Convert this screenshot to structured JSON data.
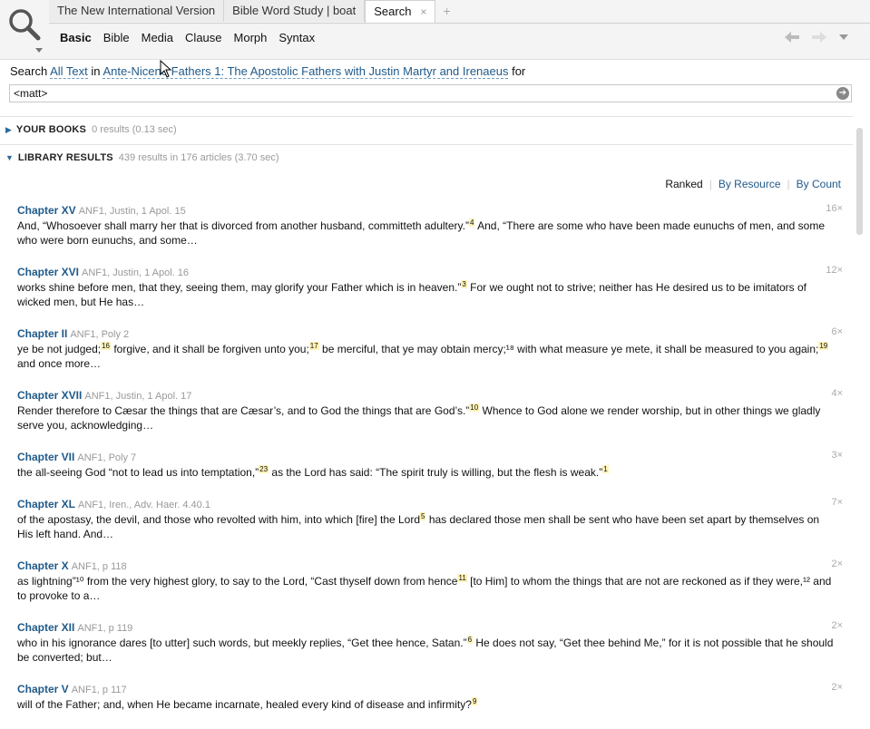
{
  "tabs": [
    {
      "label": "The New International Version",
      "active": false
    },
    {
      "label": "Bible Word Study | boat",
      "active": false
    },
    {
      "label": "Search",
      "active": true
    }
  ],
  "tab_close_glyph": "×",
  "tab_add_glyph": "+",
  "subnav": [
    {
      "label": "Basic",
      "active": true
    },
    {
      "label": "Bible",
      "active": false
    },
    {
      "label": "Media",
      "active": false
    },
    {
      "label": "Clause",
      "active": false
    },
    {
      "label": "Morph",
      "active": false
    },
    {
      "label": "Syntax",
      "active": false
    }
  ],
  "nav": {
    "back_icon": "arrow-left-icon",
    "forward_icon": "arrow-right-icon",
    "menu_icon": "chevron-down-icon"
  },
  "searchline": {
    "prefix": "Search",
    "scope": "All Text",
    "in": "in",
    "resource": "Ante-Nicene Fathers 1: The Apostolic Fathers with Justin Martyr and Irenaeus",
    "for": "for"
  },
  "search": {
    "value": "<matt>"
  },
  "your_books": {
    "label": "YOUR BOOKS",
    "meta": "0 results (0.13 sec)"
  },
  "library": {
    "label": "LIBRARY RESULTS",
    "meta": "439 results in 176 articles (3.70 sec)"
  },
  "sort": {
    "current": "Ranked",
    "opt1": "By Resource",
    "opt2": "By Count"
  },
  "results": [
    {
      "chapter": "Chapter XV",
      "source": "ANF1, Justin, 1 Apol. 15",
      "count": "16×",
      "parts": [
        "And, “Whosoever shall marry her that is divorced from another husband, committeth adultery.”",
        "4",
        " And, “There are some who have been made eunuchs of men, and some who were born eunuchs, and some…"
      ]
    },
    {
      "chapter": "Chapter XVI",
      "source": "ANF1, Justin, 1 Apol. 16",
      "count": "12×",
      "parts": [
        "works shine before men, that they, seeing them, may glorify your Father which is in heaven.”",
        "3",
        " For we ought not to strive; neither has He desired us to be imitators of wicked men, but He has…"
      ]
    },
    {
      "chapter": "Chapter II",
      "source": "ANF1, Poly 2",
      "count": "6×",
      "parts": [
        "ye be not judged;",
        "16",
        " forgive, and it shall be forgiven unto you;",
        "17",
        " be merciful, that ye may obtain mercy;¹⁸ with what measure ye mete, it shall be measured to you again;",
        "19",
        " and once more…"
      ]
    },
    {
      "chapter": "Chapter XVII",
      "source": "ANF1, Justin, 1 Apol. 17",
      "count": "4×",
      "parts": [
        "Render therefore to Cæsar the things that are Cæsar’s, and to God the things that are God’s.”",
        "10",
        " Whence to God alone we render worship, but in other things we gladly serve you, acknowledging…"
      ]
    },
    {
      "chapter": "Chapter VII",
      "source": "ANF1, Poly 7",
      "count": "3×",
      "parts": [
        "the all-seeing God “not to lead us into temptation,”",
        "23",
        " as the Lord has said: “The spirit truly is willing, but the flesh is weak.”",
        "1",
        ""
      ]
    },
    {
      "chapter": "Chapter XL",
      "source": "ANF1, Iren., Adv. Haer. 4.40.1",
      "count": "7×",
      "parts": [
        "of the apostasy, the devil, and those who revolted with him, into which [fire] the Lord",
        "5",
        " has declared those men shall be sent who have been set apart by themselves on His left hand. And…"
      ]
    },
    {
      "chapter": "Chapter X",
      "source": "ANF1, p 118",
      "count": "2×",
      "parts": [
        "as lightning”¹⁰ from the very highest glory, to say to the Lord, “Cast thyself down from hence",
        "11",
        " [to Him] to whom the things that are not are reckoned as if they were,¹² and to provoke to a…"
      ]
    },
    {
      "chapter": "Chapter XII",
      "source": "ANF1, p 119",
      "count": "2×",
      "parts": [
        "who in his ignorance dares [to utter] such words, but meekly replies, “Get thee hence, Satan.”",
        "6",
        " He does not say, “Get thee behind Me,” for it is not possible that he should be converted; but…"
      ]
    },
    {
      "chapter": "Chapter V",
      "source": "ANF1, p 117",
      "count": "2×",
      "parts": [
        "will of the Father; and, when He became incarnate, healed every kind of disease and infirmity?",
        "9",
        ""
      ]
    }
  ]
}
